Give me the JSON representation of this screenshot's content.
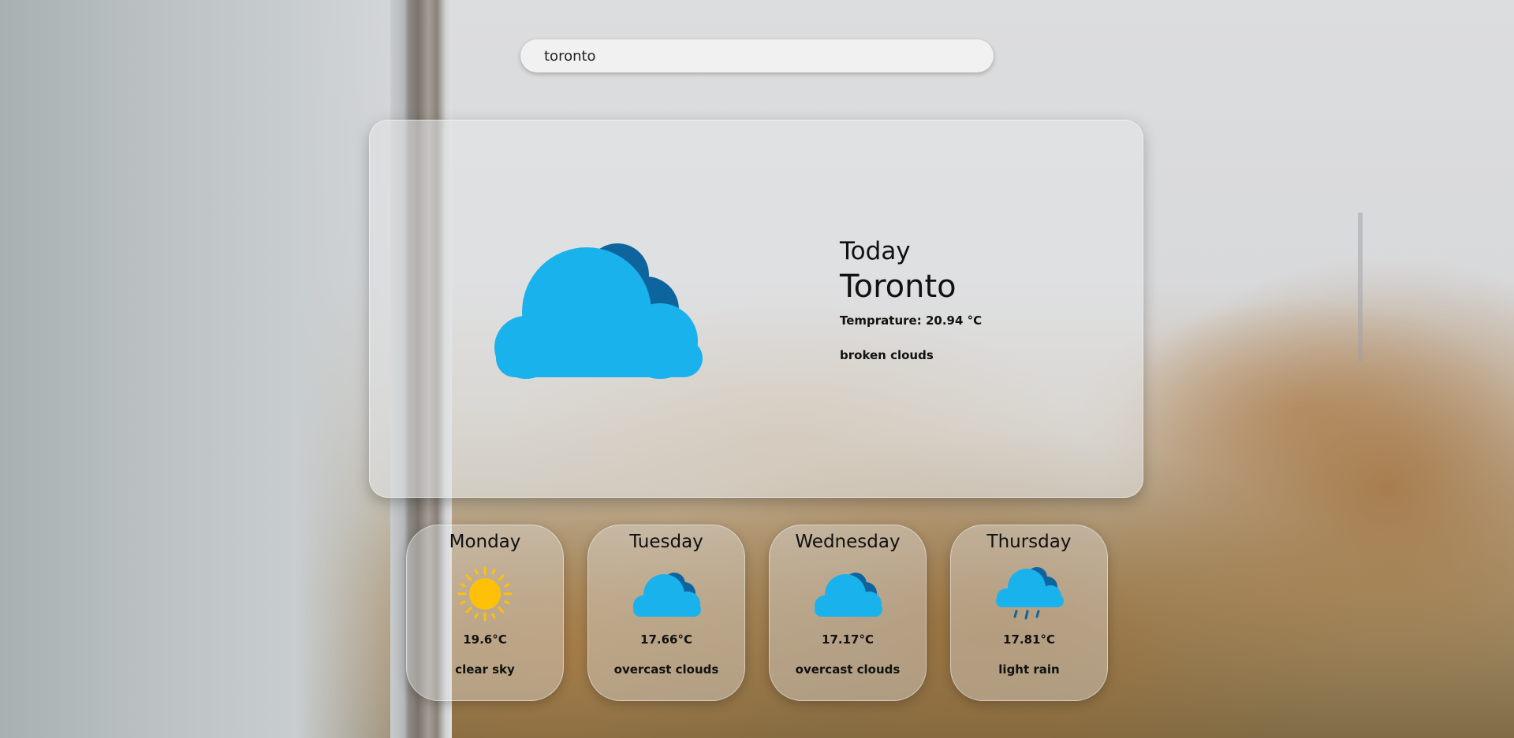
{
  "search": {
    "value": "toronto"
  },
  "today": {
    "label": "Today",
    "city": "Toronto",
    "temperature": "Temprature: 20.94 °C",
    "description": "broken clouds",
    "icon": "broken-clouds-icon"
  },
  "forecast": [
    {
      "day": "Monday",
      "temp": "19.6°C",
      "desc": "clear sky",
      "icon": "sun-icon"
    },
    {
      "day": "Tuesday",
      "temp": "17.66°C",
      "desc": "overcast clouds",
      "icon": "cloud-icon"
    },
    {
      "day": "Wednesday",
      "temp": "17.17°C",
      "desc": "overcast clouds",
      "icon": "cloud-icon"
    },
    {
      "day": "Thursday",
      "temp": "17.81°C",
      "desc": "light rain",
      "icon": "rain-cloud-icon"
    }
  ],
  "colors": {
    "cloud_light": "#1ab2ec",
    "cloud_dark": "#0e659e",
    "sun": "#ffc107"
  }
}
